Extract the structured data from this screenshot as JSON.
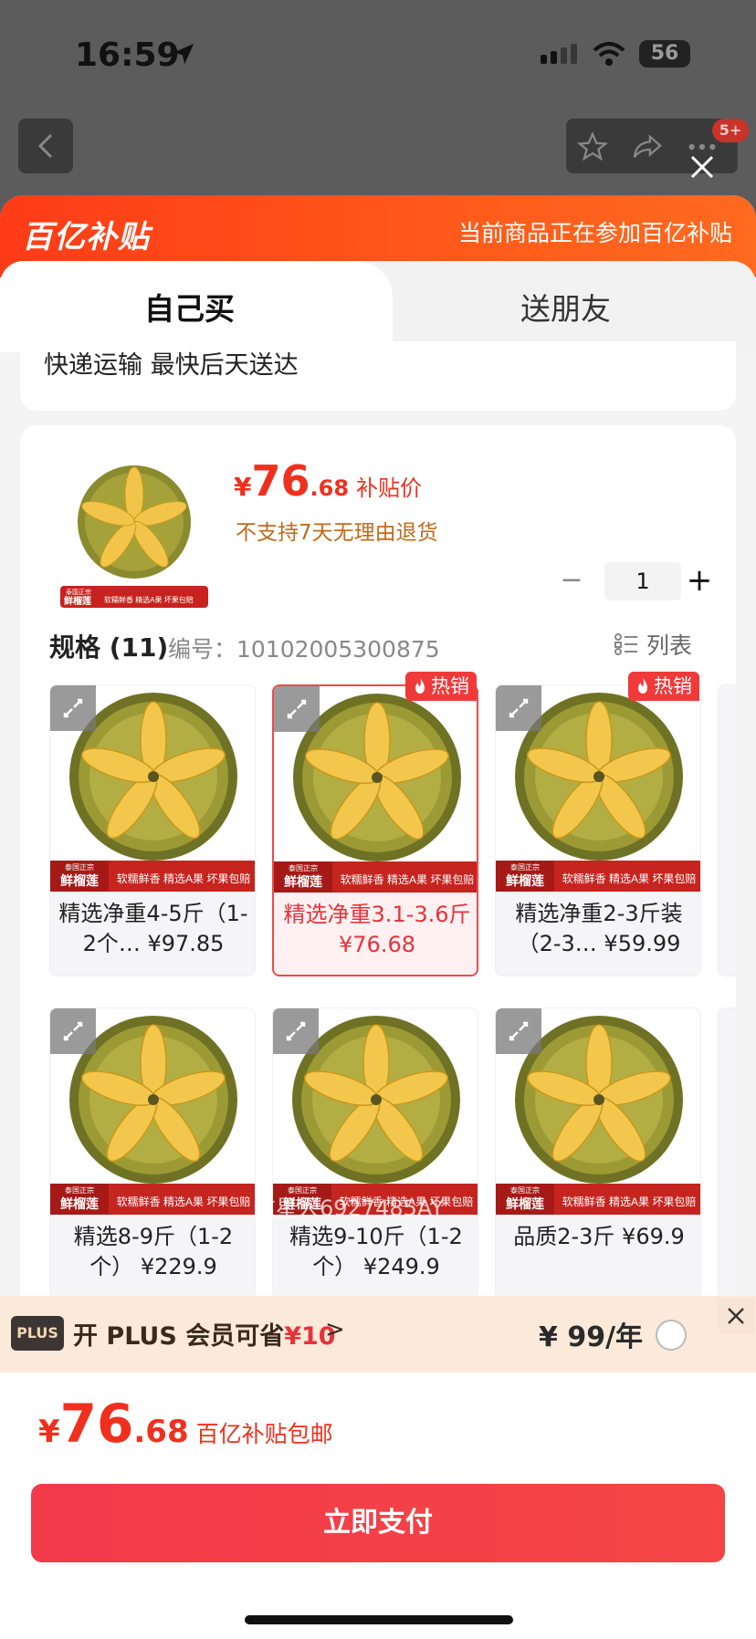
{
  "status": {
    "time": "16:59",
    "battery": "56"
  },
  "nav": {
    "badge": "5+"
  },
  "subsidy": {
    "logo": "百亿补贴",
    "tip": "当前商品正在参加百亿补贴"
  },
  "tabs": [
    {
      "label": "自己买",
      "active": true
    },
    {
      "label": "送朋友",
      "active": false
    }
  ],
  "shipping": "快递运输 最快后天送达",
  "product": {
    "price_yen": "¥",
    "price_int": "76",
    "price_dec": ".68",
    "price_label": "补贴价",
    "no_return": "不支持7天无理由退货",
    "quantity": "1",
    "thumb_label_1": "泰国正宗",
    "thumb_label_2": "鲜榴莲",
    "thumb_label_3": "软糯鲜香 精选A果 坏果包赔"
  },
  "spec": {
    "title": "规格 (11)",
    "code": "编号：10102005300875",
    "list_label": "列表"
  },
  "variants": [
    {
      "caption": "精选净重4-5斤（1-2个… ¥97.85",
      "selected": false,
      "hot": false
    },
    {
      "caption": "精选净重3.1-3.6斤 ¥76.68",
      "selected": true,
      "hot": true
    },
    {
      "caption": "精选净重2-3斤装（2-3… ¥59.99",
      "selected": false,
      "hot": true
    },
    {
      "caption": "精选8-9斤（1-2个） ¥229.9",
      "selected": false,
      "hot": false
    },
    {
      "caption": "精选9-10斤（1-2个） ¥249.9",
      "selected": false,
      "hot": false
    },
    {
      "caption": "品质2-3斤 ¥69.9",
      "selected": false,
      "hot": false
    }
  ],
  "hot_label": "热销",
  "watermark": "信星人6927485AY",
  "plus": {
    "tag": "PLUS",
    "text_prefix": "开 PLUS 会员可省",
    "amount": "¥10",
    "chevron": ">",
    "price": "¥ 99/年"
  },
  "bottom": {
    "yen": "¥",
    "int": "76",
    "dec": ".68",
    "label": "百亿补贴包邮",
    "pay": "立即支付"
  },
  "colors": {
    "accent": "#f0301e",
    "subsidy_bar": "#ff4a1a",
    "pay_button": "#f23a4a"
  }
}
